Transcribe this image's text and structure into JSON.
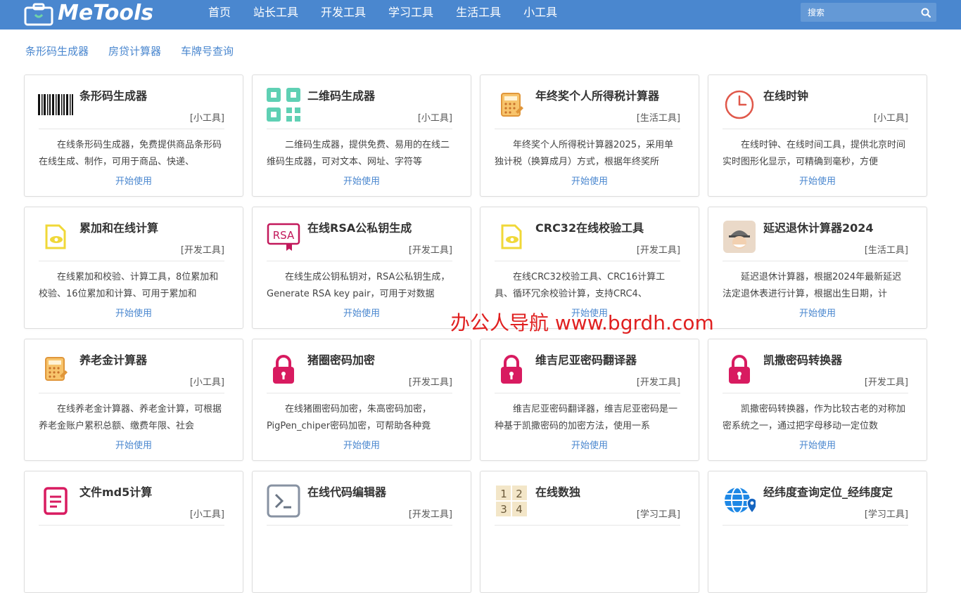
{
  "header": {
    "logo_text": "MeTools",
    "nav": [
      "首页",
      "站长工具",
      "开发工具",
      "学习工具",
      "生活工具",
      "小工具"
    ],
    "search_placeholder": "搜索"
  },
  "quick_links": [
    "条形码生成器",
    "房贷计算器",
    "车牌号查询"
  ],
  "cards": [
    {
      "title": "条形码生成器",
      "category": "[小工具]",
      "desc": "在线条形码生成器，免费提供商品条形码在线生成、制作，可用于商品、快递、",
      "link": "开始使用",
      "icon": "barcode-icon"
    },
    {
      "title": "二维码生成器",
      "category": "[小工具]",
      "desc": "二维码生成器，提供免费、易用的在线二维码生成器，可对文本、网址、字符等",
      "link": "开始使用",
      "icon": "qrcode-icon"
    },
    {
      "title": "年终奖个人所得税计算器",
      "category": "[生活工具]",
      "desc": "年终奖个人所得税计算器2025，采用单独计税（换算成月）方式，根据年终奖所",
      "link": "开始使用",
      "icon": "calculator-icon"
    },
    {
      "title": "在线时钟",
      "category": "[小工具]",
      "desc": "在线时钟、在线时间工具，提供北京时间实时图形化显示，可精确到毫秒，方便",
      "link": "开始使用",
      "icon": "clock-icon"
    },
    {
      "title": "累加和在线计算",
      "category": "[开发工具]",
      "desc": "在线累加和校验、计算工具，8位累加和校验、16位累加和计算、可用于累加和",
      "link": "开始使用",
      "icon": "file-eye-icon"
    },
    {
      "title": "在线RSA公私钥生成",
      "category": "[开发工具]",
      "desc": "在线生成公钥私钥对，RSA公私钥生成，Generate RSA key pair，可用于对数据",
      "link": "开始使用",
      "icon": "rsa-badge-icon"
    },
    {
      "title": "CRC32在线校验工具",
      "category": "[开发工具]",
      "desc": "在线CRC32校验工具、CRC16计算工具、循环冗余校验计算，支持CRC4、",
      "link": "开始使用",
      "icon": "file-eye-icon"
    },
    {
      "title": "延迟退休计算器2024",
      "category": "[生活工具]",
      "desc": "延迟退休计算器，根据2024年最新延迟法定退休表进行计算，根据出生日期，计",
      "link": "开始使用",
      "icon": "elder-avatar-icon"
    },
    {
      "title": "养老金计算器",
      "category": "[小工具]",
      "desc": "在线养老金计算器、养老金计算，可根据养老金账户累积总额、缴费年限、社会",
      "link": "开始使用",
      "icon": "calculator-icon"
    },
    {
      "title": "猪圈密码加密",
      "category": "[开发工具]",
      "desc": "在线猪圈密码加密，朱高密码加密，PigPen_chiper密码加密，可帮助各种竟",
      "link": "开始使用",
      "icon": "lock-icon"
    },
    {
      "title": "维吉尼亚密码翻译器",
      "category": "[开发工具]",
      "desc": "维吉尼亚密码翻译器，维吉尼亚密码是一种基于凯撒密码的加密方法，使用一系",
      "link": "开始使用",
      "icon": "lock-icon"
    },
    {
      "title": "凯撒密码转换器",
      "category": "[开发工具]",
      "desc": "凯撒密码转换器，作为比较古老的对称加密系统之一，通过把字母移动一定位数",
      "link": "开始使用",
      "icon": "lock-icon"
    },
    {
      "title": "文件md5计算",
      "category": "[小工具]",
      "desc": "",
      "link": "",
      "icon": "document-icon"
    },
    {
      "title": "在线代码编辑器",
      "category": "[开发工具]",
      "desc": "",
      "link": "",
      "icon": "terminal-icon"
    },
    {
      "title": "在线数独",
      "category": "[学习工具]",
      "desc": "",
      "link": "",
      "icon": "sudoku-icon"
    },
    {
      "title": "经纬度查询定位_经纬度定",
      "category": "[学习工具]",
      "desc": "",
      "link": "",
      "icon": "globe-pin-icon"
    }
  ],
  "sudoku_digits": [
    "1",
    "2",
    "3",
    "4"
  ],
  "rsa_label": "RSA",
  "watermark": "办公人导航  www.bgrdh.com"
}
